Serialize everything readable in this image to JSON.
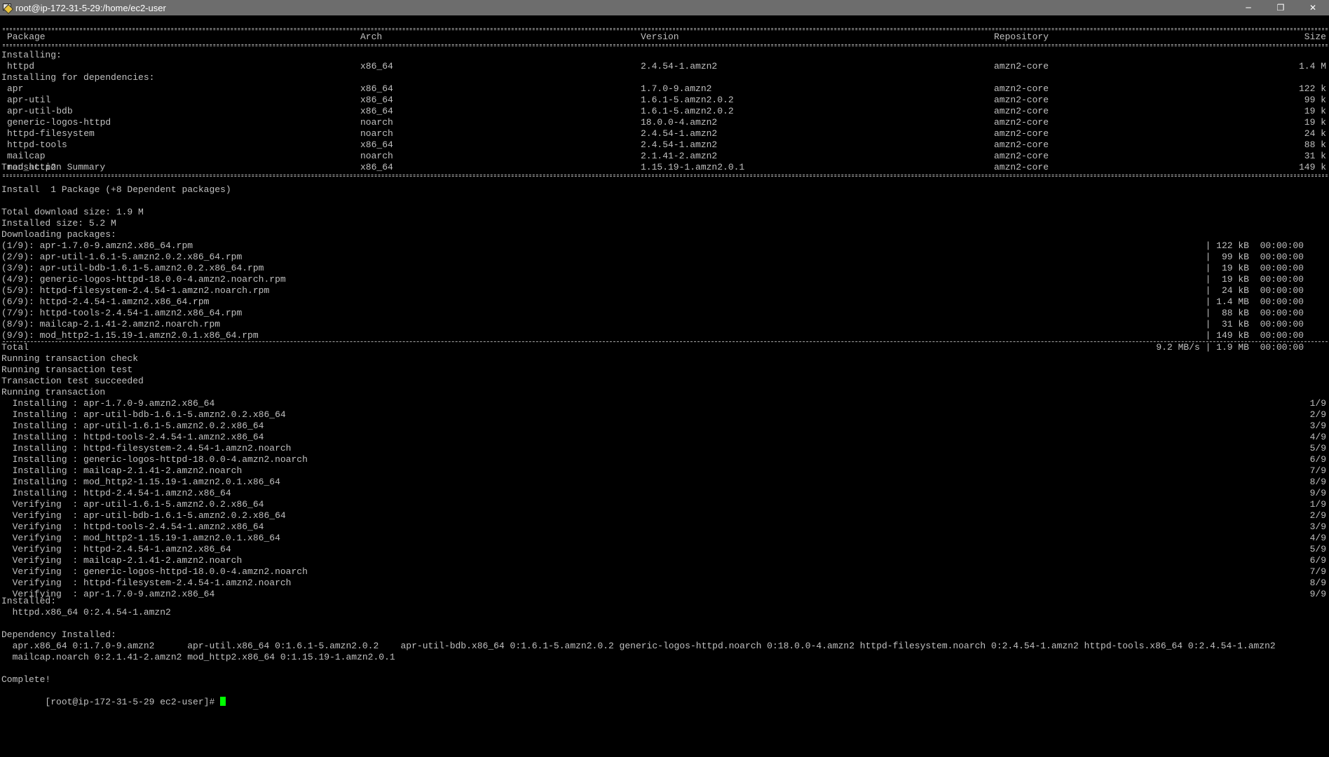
{
  "window": {
    "title": "root@ip-172-31-5-29:/home/ec2-user",
    "controls": {
      "minimize": "─",
      "restore": "❐",
      "close": "✕"
    }
  },
  "table": {
    "headers": {
      "package": "Package",
      "arch": "Arch",
      "version": "Version",
      "repository": "Repository",
      "size": "Size"
    },
    "installing_label": "Installing:",
    "installing": [
      {
        "name": "httpd",
        "arch": "x86_64",
        "version": "2.4.54-1.amzn2",
        "repo": "amzn2-core",
        "size": "1.4 M"
      }
    ],
    "deps_label": "Installing for dependencies:",
    "deps": [
      {
        "name": "apr",
        "arch": "x86_64",
        "version": "1.7.0-9.amzn2",
        "repo": "amzn2-core",
        "size": "122 k"
      },
      {
        "name": "apr-util",
        "arch": "x86_64",
        "version": "1.6.1-5.amzn2.0.2",
        "repo": "amzn2-core",
        "size": "99 k"
      },
      {
        "name": "apr-util-bdb",
        "arch": "x86_64",
        "version": "1.6.1-5.amzn2.0.2",
        "repo": "amzn2-core",
        "size": "19 k"
      },
      {
        "name": "generic-logos-httpd",
        "arch": "noarch",
        "version": "18.0.0-4.amzn2",
        "repo": "amzn2-core",
        "size": "19 k"
      },
      {
        "name": "httpd-filesystem",
        "arch": "noarch",
        "version": "2.4.54-1.amzn2",
        "repo": "amzn2-core",
        "size": "24 k"
      },
      {
        "name": "httpd-tools",
        "arch": "x86_64",
        "version": "2.4.54-1.amzn2",
        "repo": "amzn2-core",
        "size": "88 k"
      },
      {
        "name": "mailcap",
        "arch": "noarch",
        "version": "2.1.41-2.amzn2",
        "repo": "amzn2-core",
        "size": "31 k"
      },
      {
        "name": "mod_http2",
        "arch": "x86_64",
        "version": "1.15.19-1.amzn2.0.1",
        "repo": "amzn2-core",
        "size": "149 k"
      }
    ]
  },
  "summary": {
    "title": "Transaction Summary",
    "install_line": "Install  1 Package (+8 Dependent packages)",
    "total_download": "Total download size: 1.9 M",
    "installed_size": "Installed size: 5.2 M",
    "downloading": "Downloading packages:"
  },
  "downloads": [
    {
      "file": "(1/9): apr-1.7.0-9.amzn2.x86_64.rpm",
      "stats": "| 122 kB  00:00:00"
    },
    {
      "file": "(2/9): apr-util-1.6.1-5.amzn2.0.2.x86_64.rpm",
      "stats": "|  99 kB  00:00:00"
    },
    {
      "file": "(3/9): apr-util-bdb-1.6.1-5.amzn2.0.2.x86_64.rpm",
      "stats": "|  19 kB  00:00:00"
    },
    {
      "file": "(4/9): generic-logos-httpd-18.0.0-4.amzn2.noarch.rpm",
      "stats": "|  19 kB  00:00:00"
    },
    {
      "file": "(5/9): httpd-filesystem-2.4.54-1.amzn2.noarch.rpm",
      "stats": "|  24 kB  00:00:00"
    },
    {
      "file": "(6/9): httpd-2.4.54-1.amzn2.x86_64.rpm",
      "stats": "| 1.4 MB  00:00:00"
    },
    {
      "file": "(7/9): httpd-tools-2.4.54-1.amzn2.x86_64.rpm",
      "stats": "|  88 kB  00:00:00"
    },
    {
      "file": "(8/9): mailcap-2.1.41-2.amzn2.noarch.rpm",
      "stats": "|  31 kB  00:00:00"
    },
    {
      "file": "(9/9): mod_http2-1.15.19-1.amzn2.0.1.x86_64.rpm",
      "stats": "| 149 kB  00:00:00"
    }
  ],
  "total": {
    "label": "Total",
    "stats": "9.2 MB/s | 1.9 MB  00:00:00"
  },
  "transaction_msgs": [
    "Running transaction check",
    "Running transaction test",
    "Transaction test succeeded",
    "Running transaction"
  ],
  "steps": [
    {
      "text": "  Installing : apr-1.7.0-9.amzn2.x86_64",
      "progress": "1/9"
    },
    {
      "text": "  Installing : apr-util-bdb-1.6.1-5.amzn2.0.2.x86_64",
      "progress": "2/9"
    },
    {
      "text": "  Installing : apr-util-1.6.1-5.amzn2.0.2.x86_64",
      "progress": "3/9"
    },
    {
      "text": "  Installing : httpd-tools-2.4.54-1.amzn2.x86_64",
      "progress": "4/9"
    },
    {
      "text": "  Installing : httpd-filesystem-2.4.54-1.amzn2.noarch",
      "progress": "5/9"
    },
    {
      "text": "  Installing : generic-logos-httpd-18.0.0-4.amzn2.noarch",
      "progress": "6/9"
    },
    {
      "text": "  Installing : mailcap-2.1.41-2.amzn2.noarch",
      "progress": "7/9"
    },
    {
      "text": "  Installing : mod_http2-1.15.19-1.amzn2.0.1.x86_64",
      "progress": "8/9"
    },
    {
      "text": "  Installing : httpd-2.4.54-1.amzn2.x86_64",
      "progress": "9/9"
    },
    {
      "text": "  Verifying  : apr-util-1.6.1-5.amzn2.0.2.x86_64",
      "progress": "1/9"
    },
    {
      "text": "  Verifying  : apr-util-bdb-1.6.1-5.amzn2.0.2.x86_64",
      "progress": "2/9"
    },
    {
      "text": "  Verifying  : httpd-tools-2.4.54-1.amzn2.x86_64",
      "progress": "3/9"
    },
    {
      "text": "  Verifying  : mod_http2-1.15.19-1.amzn2.0.1.x86_64",
      "progress": "4/9"
    },
    {
      "text": "  Verifying  : httpd-2.4.54-1.amzn2.x86_64",
      "progress": "5/9"
    },
    {
      "text": "  Verifying  : mailcap-2.1.41-2.amzn2.noarch",
      "progress": "6/9"
    },
    {
      "text": "  Verifying  : generic-logos-httpd-18.0.0-4.amzn2.noarch",
      "progress": "7/9"
    },
    {
      "text": "  Verifying  : httpd-filesystem-2.4.54-1.amzn2.noarch",
      "progress": "8/9"
    },
    {
      "text": "  Verifying  : apr-1.7.0-9.amzn2.x86_64",
      "progress": "9/9"
    }
  ],
  "installed": {
    "label": "Installed:",
    "line": "  httpd.x86_64 0:2.4.54-1.amzn2"
  },
  "dependency_installed": {
    "label": "Dependency Installed:",
    "line1": "  apr.x86_64 0:1.7.0-9.amzn2      apr-util.x86_64 0:1.6.1-5.amzn2.0.2    apr-util-bdb.x86_64 0:1.6.1-5.amzn2.0.2 generic-logos-httpd.noarch 0:18.0.0-4.amzn2 httpd-filesystem.noarch 0:2.4.54-1.amzn2 httpd-tools.x86_64 0:2.4.54-1.amzn2",
    "line2": "  mailcap.noarch 0:2.1.41-2.amzn2 mod_http2.x86_64 0:1.15.19-1.amzn2.0.1"
  },
  "complete": "Complete!",
  "prompt": "[root@ip-172-31-5-29 ec2-user]# ",
  "colors": {
    "background": "#000000",
    "text": "#c0c0c0",
    "cursor": "#00ff00",
    "titlebar": "#6d6d6d"
  }
}
